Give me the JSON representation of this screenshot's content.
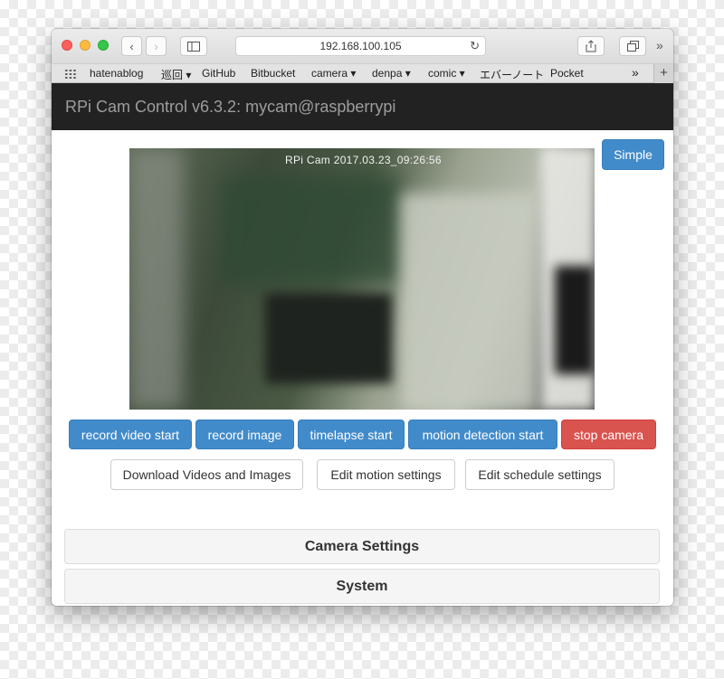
{
  "browser": {
    "address": "192.168.100.105",
    "bookmarks": [
      "hatenablog",
      "巡回 ▾",
      "GitHub",
      "Bitbucket",
      "camera ▾",
      "denpa ▾",
      "comic ▾",
      "エバーノート",
      "Pocket"
    ],
    "overflow_label": "»",
    "new_tab_label": "+"
  },
  "navbar": {
    "title": "RPi Cam Control v6.3.2: mycam@raspberrypi"
  },
  "preview": {
    "overlay": "RPi Cam  2017.03.23_09:26:56"
  },
  "buttons": {
    "simple": "Simple",
    "record_video_start": "record video start",
    "record_image": "record image",
    "timelapse_start": "timelapse start",
    "motion_detection_start": "motion detection start",
    "stop_camera": "stop camera",
    "download": "Download Videos and Images",
    "edit_motion": "Edit motion settings",
    "edit_schedule": "Edit schedule settings"
  },
  "panels": {
    "camera_settings": "Camera Settings",
    "system": "System"
  },
  "colors": {
    "primary": "#428bca",
    "danger": "#d9534f",
    "navbar": "#222222"
  }
}
